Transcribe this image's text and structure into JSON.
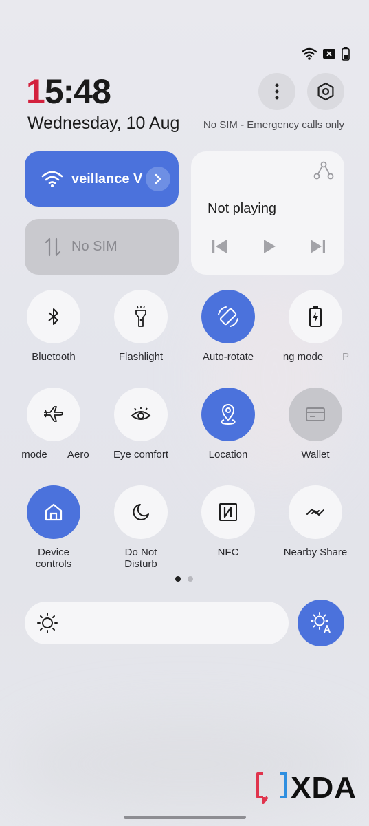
{
  "status_bar": {
    "icons": [
      "wifi-icon",
      "no-sim-icon",
      "battery-icon"
    ]
  },
  "header": {
    "time_first_digit": "1",
    "time_rest": "5:48",
    "date": "Wednesday, 10 Aug",
    "sim_status": "No SIM - Emergency calls only",
    "icons": [
      "more-options-icon",
      "settings-icon"
    ]
  },
  "wifi_tile": {
    "label": "veillance V",
    "state": "on"
  },
  "sim_tile": {
    "label": "No SIM",
    "state": "disabled"
  },
  "media": {
    "title": "Not playing",
    "icons": [
      "media-output-icon",
      "previous-icon",
      "play-icon",
      "next-icon"
    ]
  },
  "tiles": {
    "bluetooth": {
      "label": "Bluetooth",
      "state": "off"
    },
    "flashlight": {
      "label": "Flashlight",
      "state": "off"
    },
    "auto_rotate": {
      "label": "Auto-rotate",
      "state": "on"
    },
    "battery_saver": {
      "label": "ng mode",
      "state": "off",
      "peek_label": "P"
    },
    "aeroplane": {
      "label": "Aero",
      "state": "off",
      "prefix_label": "mode"
    },
    "eye_comfort": {
      "label": "Eye comfort",
      "state": "off"
    },
    "location": {
      "label": "Location",
      "state": "on"
    },
    "wallet": {
      "label": "Wallet",
      "state": "disabled"
    },
    "device_controls": {
      "label_line1": "Device",
      "label_line2": "controls",
      "state": "on"
    },
    "dnd": {
      "label_line1": "Do Not",
      "label_line2": "Disturb",
      "state": "off"
    },
    "nfc": {
      "label": "NFC",
      "state": "off"
    },
    "nearby_share": {
      "label": "Nearby Share",
      "state": "off"
    }
  },
  "pager": {
    "pages": 2,
    "current": 1
  },
  "brightness": {
    "icon": "sun-icon",
    "auto_icon": "auto-brightness-icon"
  },
  "watermark": {
    "text": "XDA"
  },
  "colors": {
    "accent": "#4b72dc",
    "tile_off": "#f6f6f8",
    "tile_disabled": "#c6c6cb",
    "clock_red": "#d3213d"
  }
}
